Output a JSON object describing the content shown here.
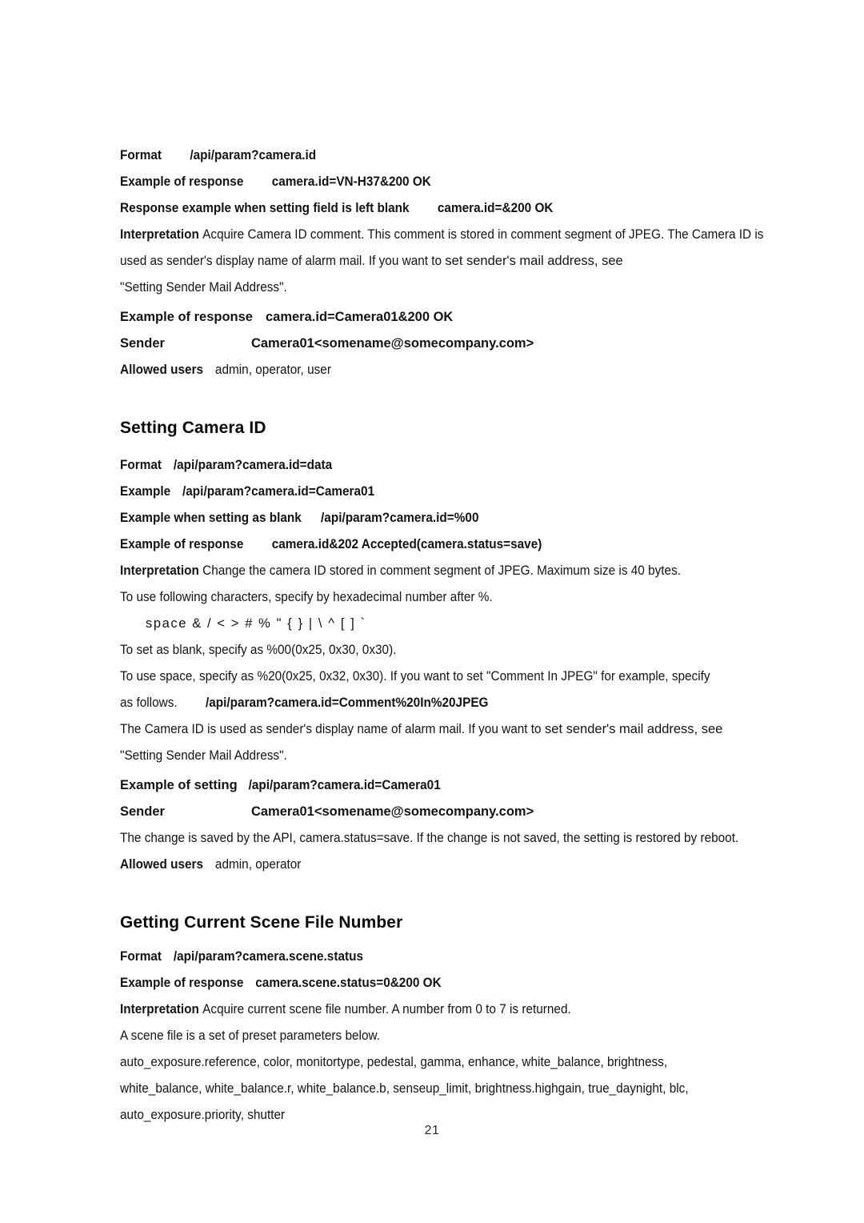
{
  "document": {
    "page_number": "21",
    "text_color": "#141414",
    "background_color": "#ffffff"
  },
  "section_camera_id_get": {
    "format_label": "Format",
    "format_value": "/api/param?camera.id",
    "example_response_label": "Example of response",
    "example_response_value": "camera.id=VN-H37&200 OK",
    "blank_response_label": "Response example when setting field is left blank",
    "blank_response_value": "camera.id=&200 OK",
    "interpretation_label": "Interpretation",
    "interpretation_part1": "Acquire Camera ID comment. This comment is stored in comment segment of JPEG. The Camera ID is used as sender's display name of alarm mail. If you want to ",
    "interpretation_wide": "set sender's mail address, see",
    "interpretation_part2": "\"Setting Sender Mail Address\".",
    "example2_label": "Example of response",
    "example2_value": "camera.id=Camera01&200 OK",
    "sender_label": "Sender",
    "sender_value": "Camera01<somename@somecompany.com>",
    "allowed_users_label": "Allowed users",
    "allowed_users_value": "admin, operator, user"
  },
  "section_setting_camera_id": {
    "heading": "Setting Camera ID",
    "format_label": "Format",
    "format_value": "/api/param?camera.id=data",
    "example_label": "Example",
    "example_value": "/api/param?camera.id=Camera01",
    "blank_label": "Example when setting as blank",
    "blank_value": "/api/param?camera.id=%00",
    "example_response_label": "Example of response",
    "example_response_value": "camera.id&202 Accepted(camera.status=save)",
    "interpretation_label": "Interpretation",
    "interpretation_value": "Change the camera ID stored in comment segment of JPEG. Maximum size is 40 bytes.",
    "chars_intro": "To use following characters, specify by hexadecimal number after %.",
    "chars_list": "space & / < > # % \" { } | \\ ^ [ ] `",
    "blank_note": "To set as blank, specify as %00(0x25, 0x30, 0x30).",
    "space_note": "To use space, specify as %20(0x25, 0x32, 0x30). If you want to set \"Comment In JPEG\" for example, specify",
    "as_follows_label": "as follows.",
    "as_follows_value": "/api/param?camera.id=Comment%20In%20JPEG",
    "sender_note_part1": "The Camera ID is used as sender's display name of alarm mail. If you want to ",
    "sender_note_wide": "set sender's mail address, see",
    "sender_note_part2": "\"Setting Sender Mail Address\".",
    "example_setting_label": "Example of setting",
    "example_setting_value": "/api/param?camera.id=Camera01",
    "sender_label": "Sender",
    "sender_value": "Camera01<somename@somecompany.com>",
    "save_note": "The change is saved by the API, camera.status=save. If the change is not saved, the setting is restored by reboot.",
    "allowed_users_label": "Allowed users",
    "allowed_users_value": "admin, operator"
  },
  "section_scene_file_number": {
    "heading": "Getting Current Scene File Number",
    "format_label": "Format",
    "format_value": "/api/param?camera.scene.status",
    "example_response_label": "Example of response",
    "example_response_value": "camera.scene.status=0&200 OK",
    "interpretation_label": "Interpretation",
    "interpretation_value": "Acquire current scene file number. A number from 0 to 7 is returned.",
    "scene_note": "A scene file is a set of preset parameters below.",
    "params_line1": " auto_exposure.reference, color, monitortype, pedestal, gamma, enhance, white_balance, brightness,",
    "params_line2": "white_balance, white_balance.r, white_balance.b, senseup_limit, brightness.highgain, true_daynight, blc,",
    "params_line3": "auto_exposure.priority, shutter"
  }
}
